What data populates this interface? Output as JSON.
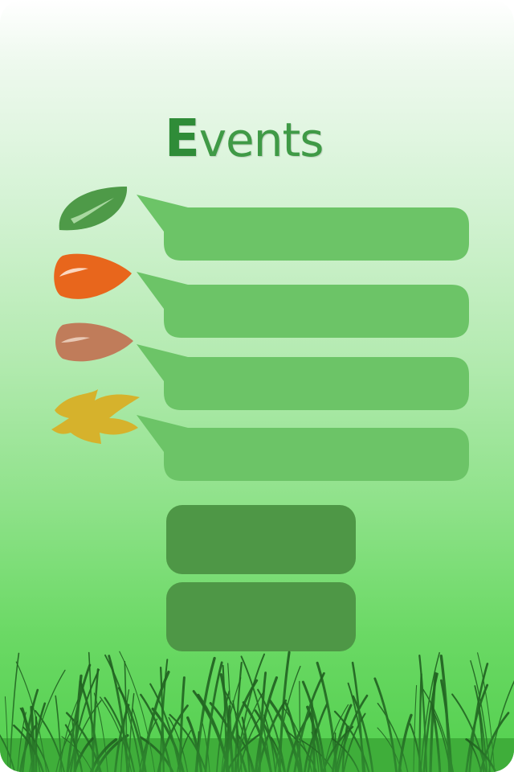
{
  "title": {
    "first_letter": "E",
    "rest": "vents"
  },
  "events": [
    {
      "leaf": "green-leaf-icon",
      "color": "#4e9a48",
      "label": ""
    },
    {
      "leaf": "orange-leaf-icon",
      "color": "#e8661c",
      "label": ""
    },
    {
      "leaf": "brown-leaf-icon",
      "color": "#c07c5a",
      "label": ""
    },
    {
      "leaf": "yellow-leaf-icon",
      "color": "#d6b22c",
      "label": ""
    }
  ],
  "buttons": [
    {
      "label": ""
    },
    {
      "label": ""
    }
  ],
  "colors": {
    "bubble": "#6cc467",
    "button": "#4e9746",
    "title": "#3f9a46",
    "grass": "#2f7a2f"
  }
}
